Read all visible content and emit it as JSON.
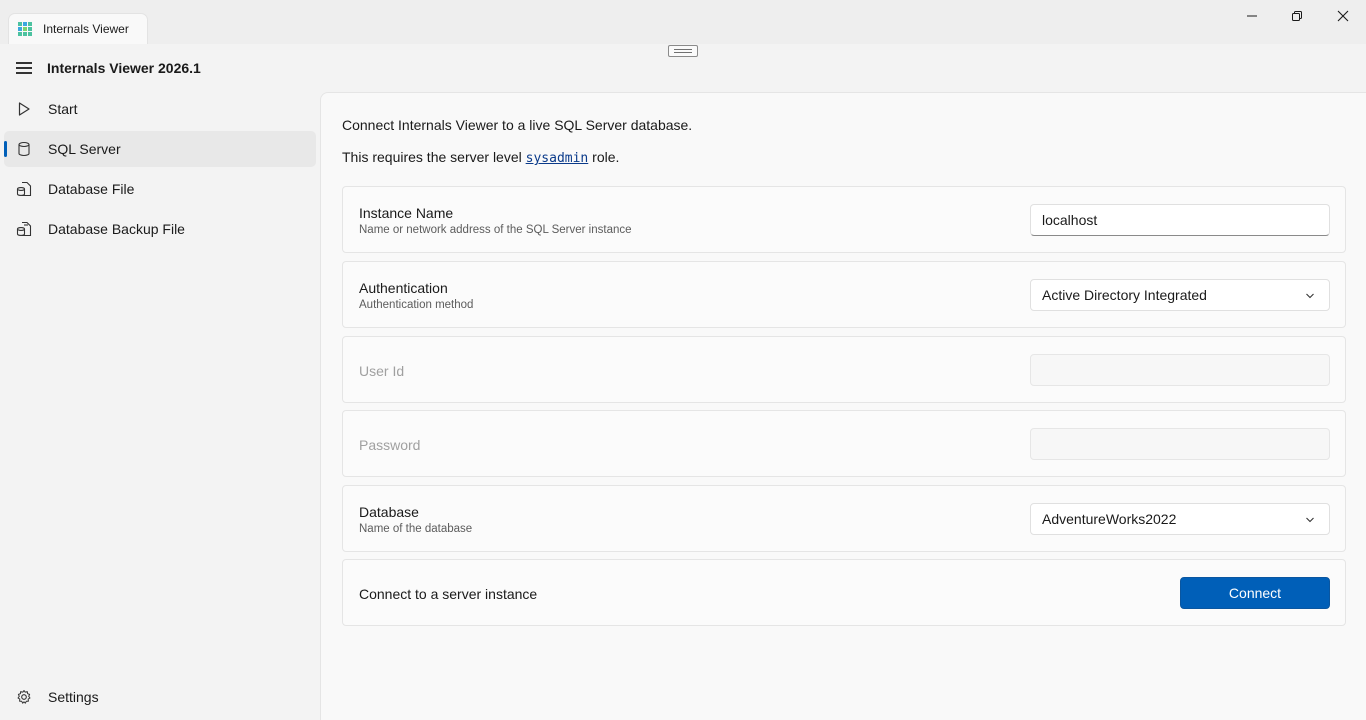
{
  "window": {
    "tab_title": "Internals Viewer",
    "icons": {
      "app": "grid-app-icon",
      "minimize": "minimize-icon",
      "maximize": "restore-icon",
      "close": "close-icon"
    }
  },
  "app": {
    "title": "Internals Viewer 2026.1"
  },
  "nav": {
    "items": [
      {
        "label": "Start",
        "icon": "play-icon",
        "selected": false
      },
      {
        "label": "SQL Server",
        "icon": "database-icon",
        "selected": true
      },
      {
        "label": "Database File",
        "icon": "database-file-icon",
        "selected": false
      },
      {
        "label": "Database Backup File",
        "icon": "database-backup-icon",
        "selected": false
      }
    ],
    "settings_label": "Settings"
  },
  "content": {
    "intro_line1": "Connect Internals Viewer to a live SQL Server database.",
    "intro_line2_prefix": "This requires the server level ",
    "intro_line2_code": "sysadmin",
    "intro_line2_suffix": " role.",
    "instance": {
      "title": "Instance Name",
      "desc": "Name or network address of the SQL Server instance",
      "value": "localhost"
    },
    "authentication": {
      "title": "Authentication",
      "desc": "Authentication method",
      "value": "Active Directory Integrated"
    },
    "user_id": {
      "title": "User Id",
      "value": ""
    },
    "password": {
      "title": "Password",
      "value": ""
    },
    "database": {
      "title": "Database",
      "desc": "Name of the database",
      "value": "AdventureWorks2022"
    },
    "connect": {
      "title": "Connect to a server instance",
      "button": "Connect"
    }
  },
  "colors": {
    "accent": "#005fb8",
    "background": "#f3f3f3",
    "content": "#f9f9f9"
  }
}
